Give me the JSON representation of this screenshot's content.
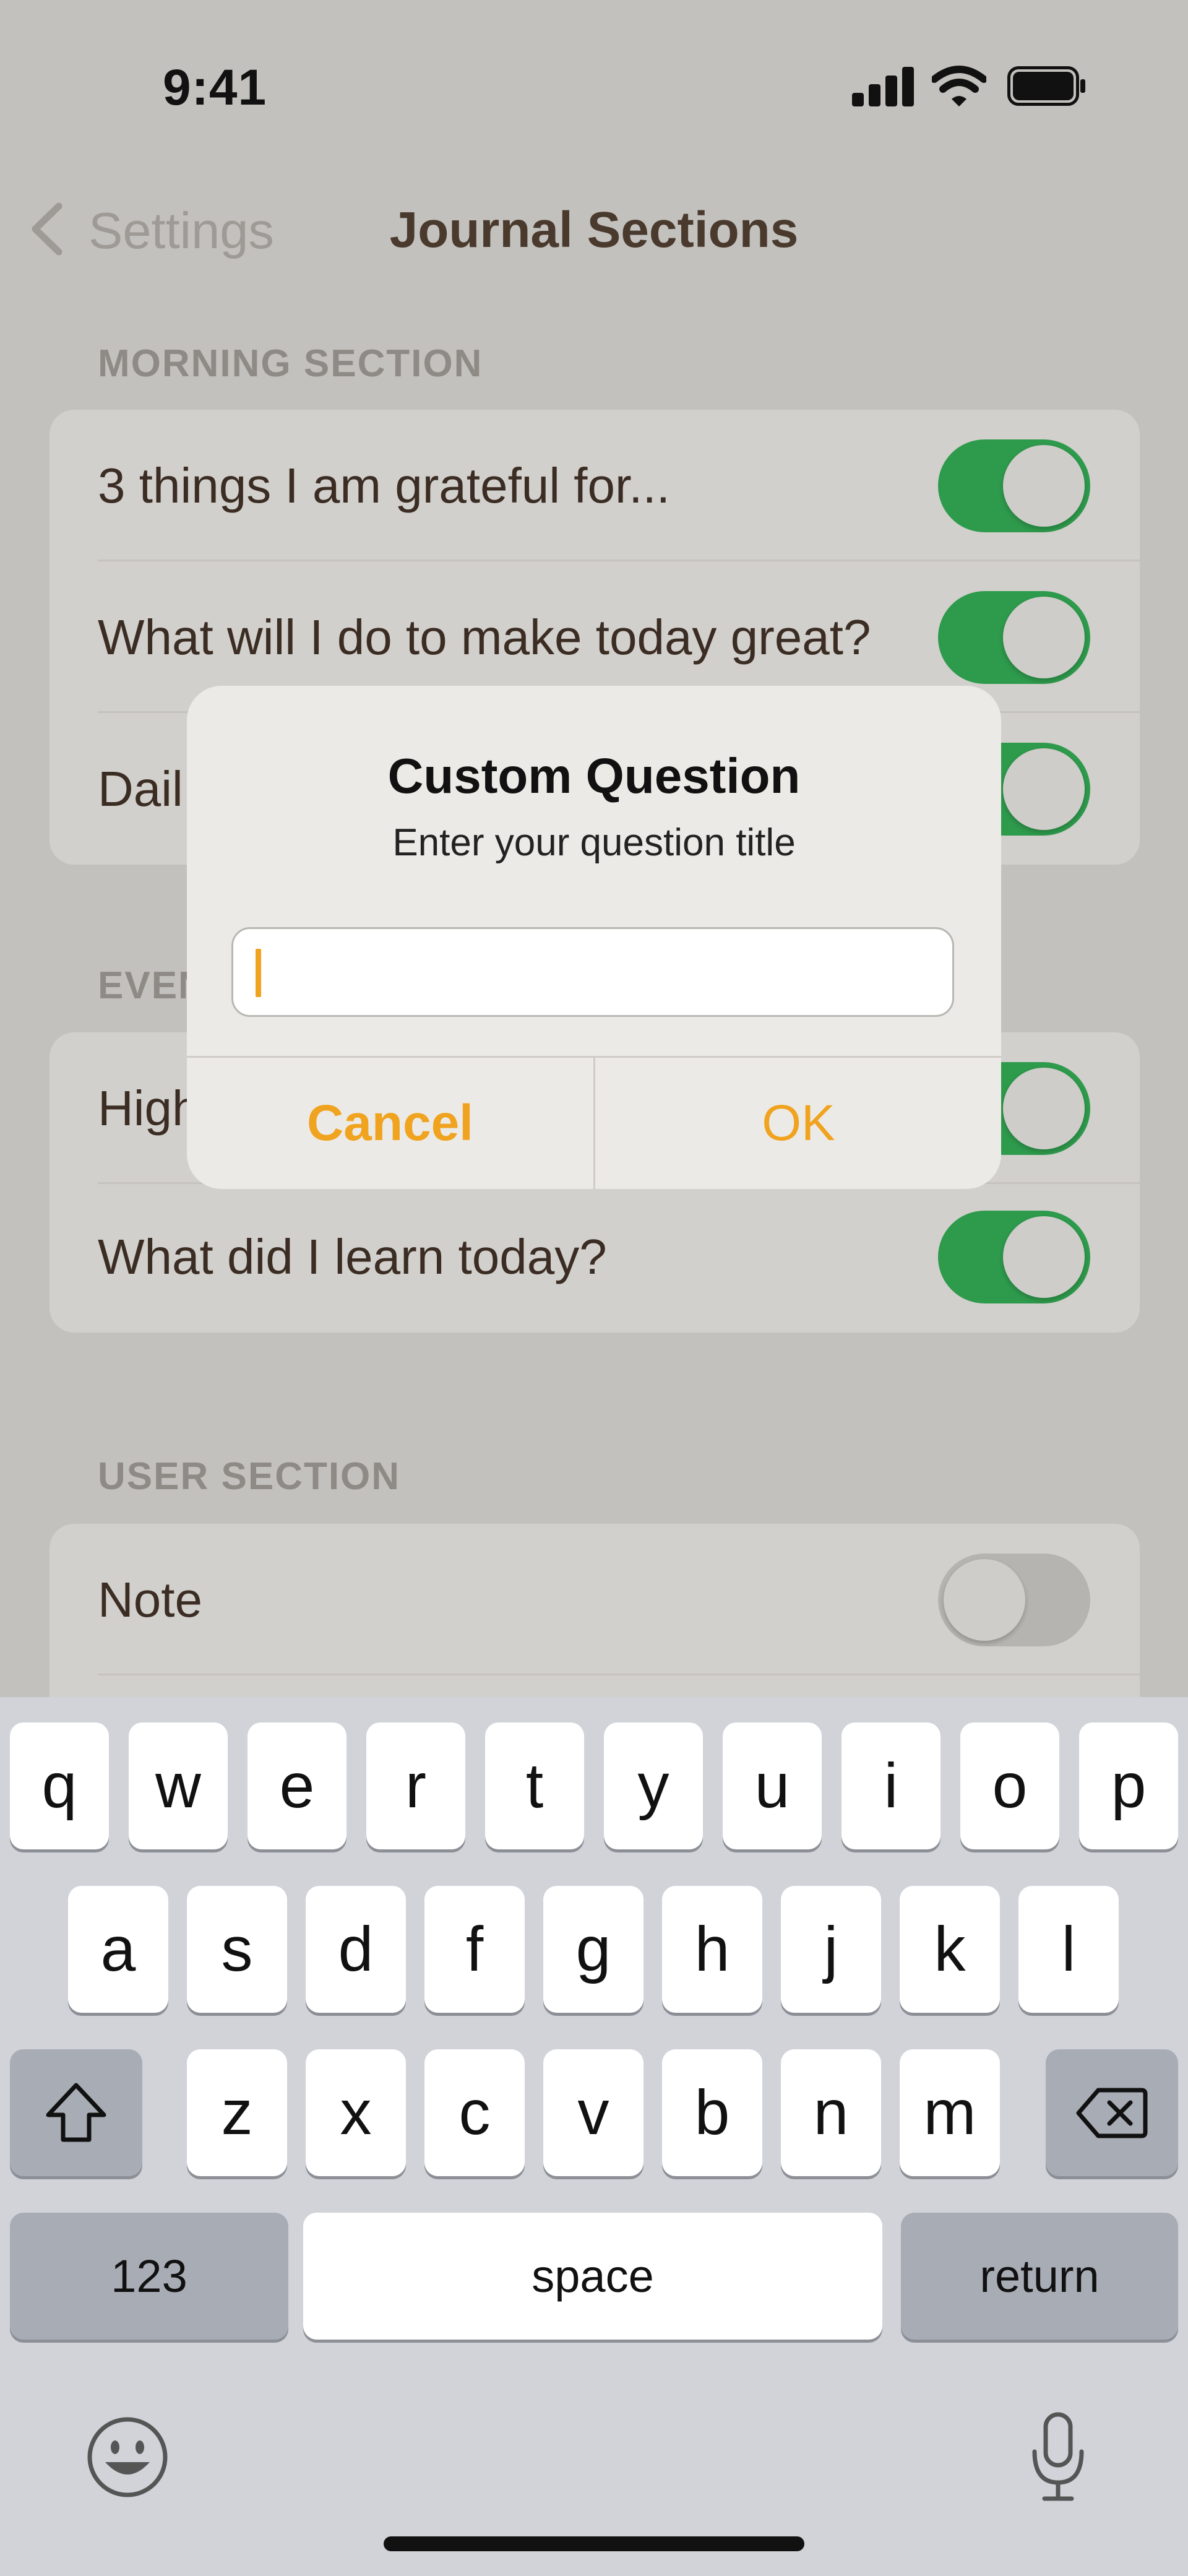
{
  "status_bar": {
    "time": "9:41"
  },
  "nav": {
    "back_label": "Settings",
    "title": "Journal Sections"
  },
  "morning": {
    "header": "MORNING SECTION",
    "rows": [
      {
        "label": "3 things I am grateful for...",
        "enabled": true
      },
      {
        "label": "What will I do to make today great?",
        "enabled": true
      },
      {
        "label": "Dail",
        "enabled": true
      }
    ]
  },
  "evening": {
    "header": "EVEN",
    "rows": [
      {
        "label": "High",
        "enabled": true
      },
      {
        "label": "What did I learn today?",
        "enabled": true
      }
    ]
  },
  "user": {
    "header": "USER SECTION",
    "rows": [
      {
        "label": "Note",
        "enabled": false
      }
    ]
  },
  "dialog": {
    "title": "Custom Question",
    "message": "Enter your question title",
    "input_value": "",
    "cancel_label": "Cancel",
    "ok_label": "OK"
  },
  "keyboard": {
    "row1": [
      "q",
      "w",
      "e",
      "r",
      "t",
      "y",
      "u",
      "i",
      "o",
      "p"
    ],
    "row2": [
      "a",
      "s",
      "d",
      "f",
      "g",
      "h",
      "j",
      "k",
      "l"
    ],
    "row3": [
      "z",
      "x",
      "c",
      "v",
      "b",
      "n",
      "m"
    ],
    "numbers_label": "123",
    "space_label": "space",
    "return_label": "return"
  },
  "colors": {
    "accent": "#F0A31F",
    "toggle_on": "#2E9A4C",
    "background": "#C3C1BD"
  }
}
